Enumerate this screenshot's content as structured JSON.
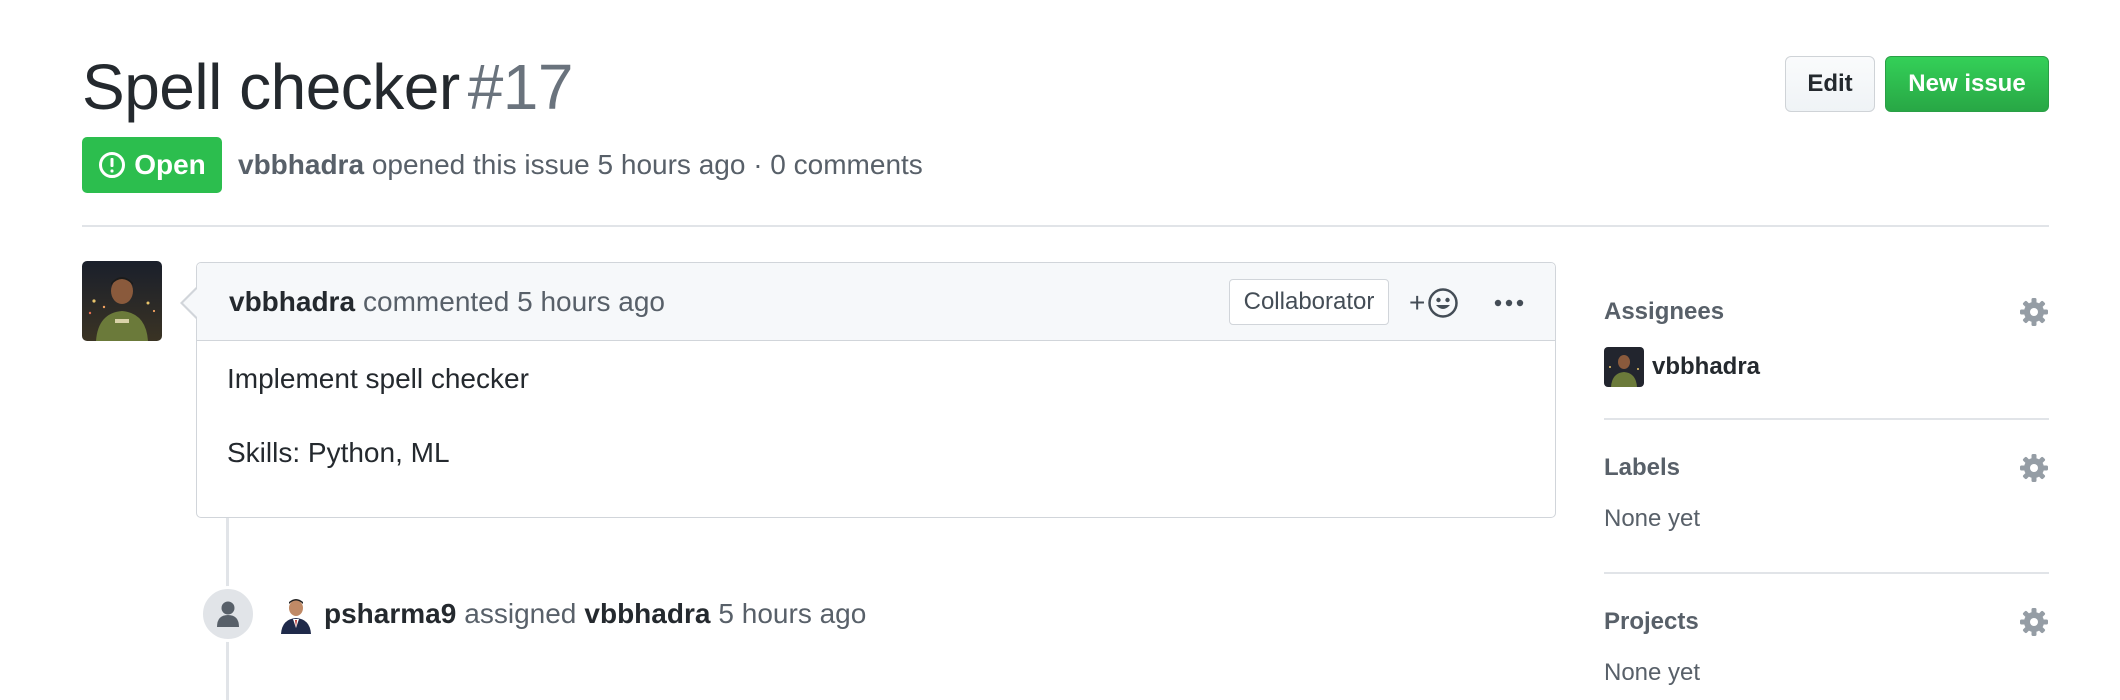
{
  "issue": {
    "title": "Spell checker",
    "number": "#17",
    "state": "Open",
    "author": "vbbhadra",
    "opened_text": "opened this issue 5 hours ago · 0 comments"
  },
  "header_actions": {
    "edit_label": "Edit",
    "new_issue_label": "New issue"
  },
  "comment": {
    "author": "vbbhadra",
    "action_text": "commented 5 hours ago",
    "role_badge": "Collaborator",
    "reaction_plus": "+",
    "body": [
      "Implement spell checker",
      "Skills: Python, ML"
    ]
  },
  "timeline_event": {
    "actor": "psharma9",
    "verb": "assigned",
    "target": "vbbhadra",
    "time": "5 hours ago"
  },
  "sidebar": {
    "assignees": {
      "title": "Assignees",
      "user": "vbbhadra"
    },
    "labels": {
      "title": "Labels",
      "value": "None yet"
    },
    "projects": {
      "title": "Projects",
      "value": "None yet"
    }
  },
  "colors": {
    "open_green": "#2cbe4e",
    "new_issue_green": "#28a745",
    "muted_text": "#586069",
    "border": "#d1d5da"
  },
  "icons": [
    "issue-opened-icon",
    "smiley-icon",
    "kebab-horizontal-icon",
    "person-icon",
    "gear-icon"
  ]
}
